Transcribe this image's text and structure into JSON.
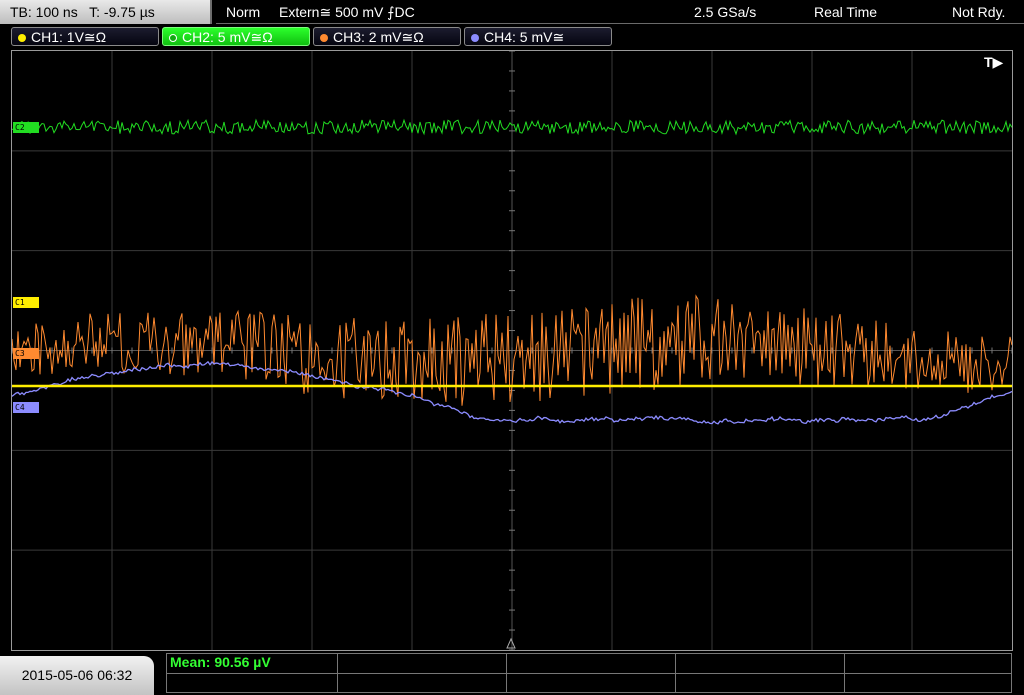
{
  "topbar": {
    "timebase": "TB: 100 ns",
    "trigger_time": "T: -9.75 µs",
    "mode": "Norm",
    "trigger_source": "Extern≅ 500 mV ⨍DC",
    "sample_rate": "2.5 GSa/s",
    "acq_mode": "Real Time",
    "status": "Not Rdy."
  },
  "channels": [
    {
      "label": "CH1: 1V≅Ω",
      "color": "#ffee00"
    },
    {
      "label": "CH2: 5 mV≅Ω",
      "color": "#22dd22"
    },
    {
      "label": "CH3: 2 mV≅Ω",
      "color": "#ff8a30"
    },
    {
      "label": "CH4: 5 mV≅",
      "color": "#8c8cff"
    }
  ],
  "markers": {
    "c2": "C2",
    "c1": "C1",
    "c3": "C3",
    "c4": "C4",
    "trigger": "T▶"
  },
  "bottom": {
    "datetime": "2015-05-06 06:32",
    "measurement": "Mean: 90.56 µV"
  }
}
